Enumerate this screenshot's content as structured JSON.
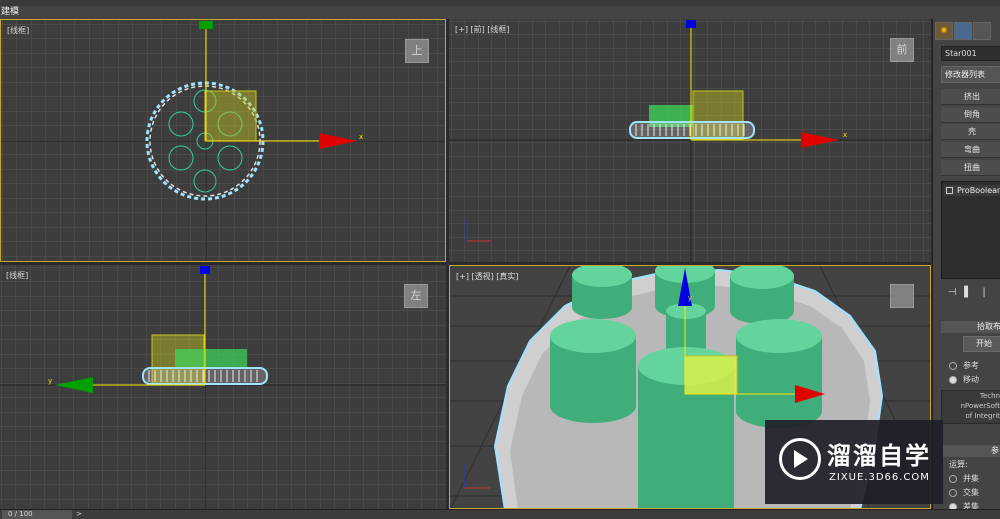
{
  "menu": {
    "label": "建模"
  },
  "viewports": {
    "top": {
      "label": "[线框]",
      "cube": "上"
    },
    "front": {
      "label": "[+] [前] [线框]",
      "cube": "前"
    },
    "left": {
      "label": "[线框]",
      "cube": "左"
    },
    "perspective": {
      "label": "[+] [透视] [真实]"
    }
  },
  "axes": {
    "x": "x",
    "y": "y"
  },
  "panel": {
    "object_name": "Star001",
    "modifier_list": "修改器列表",
    "buttons": [
      "挤出",
      "倒角",
      "壳",
      "弯曲",
      "扭曲"
    ],
    "stack_item": "ProBoolean",
    "pick_rollout": "拾取布",
    "start_button": "开始",
    "radio_options": [
      {
        "label": "参考",
        "selected": false
      },
      {
        "label": "移动",
        "selected": true
      }
    ],
    "info_lines": [
      "Techn",
      "nPowerSoft",
      "of Integrit"
    ],
    "params_rollout": "参",
    "operation_label": "运算:",
    "operations": [
      {
        "label": "并集",
        "selected": false
      },
      {
        "label": "交集",
        "selected": false
      },
      {
        "label": "差集",
        "selected": true
      }
    ]
  },
  "status": {
    "frame": "0 / 100",
    "next": ">"
  },
  "watermark": {
    "brand": "溜溜自学",
    "url": "ZIXUE.3D66.COM"
  },
  "colors": {
    "grid": "#545454",
    "selection_yellow": "#c8c81e",
    "gear_outline": "#9fe3ff",
    "x_axis": "#e00000",
    "y_axis": "#00a000",
    "z_axis": "#0000e0",
    "cylinder": "#4fc78e"
  }
}
